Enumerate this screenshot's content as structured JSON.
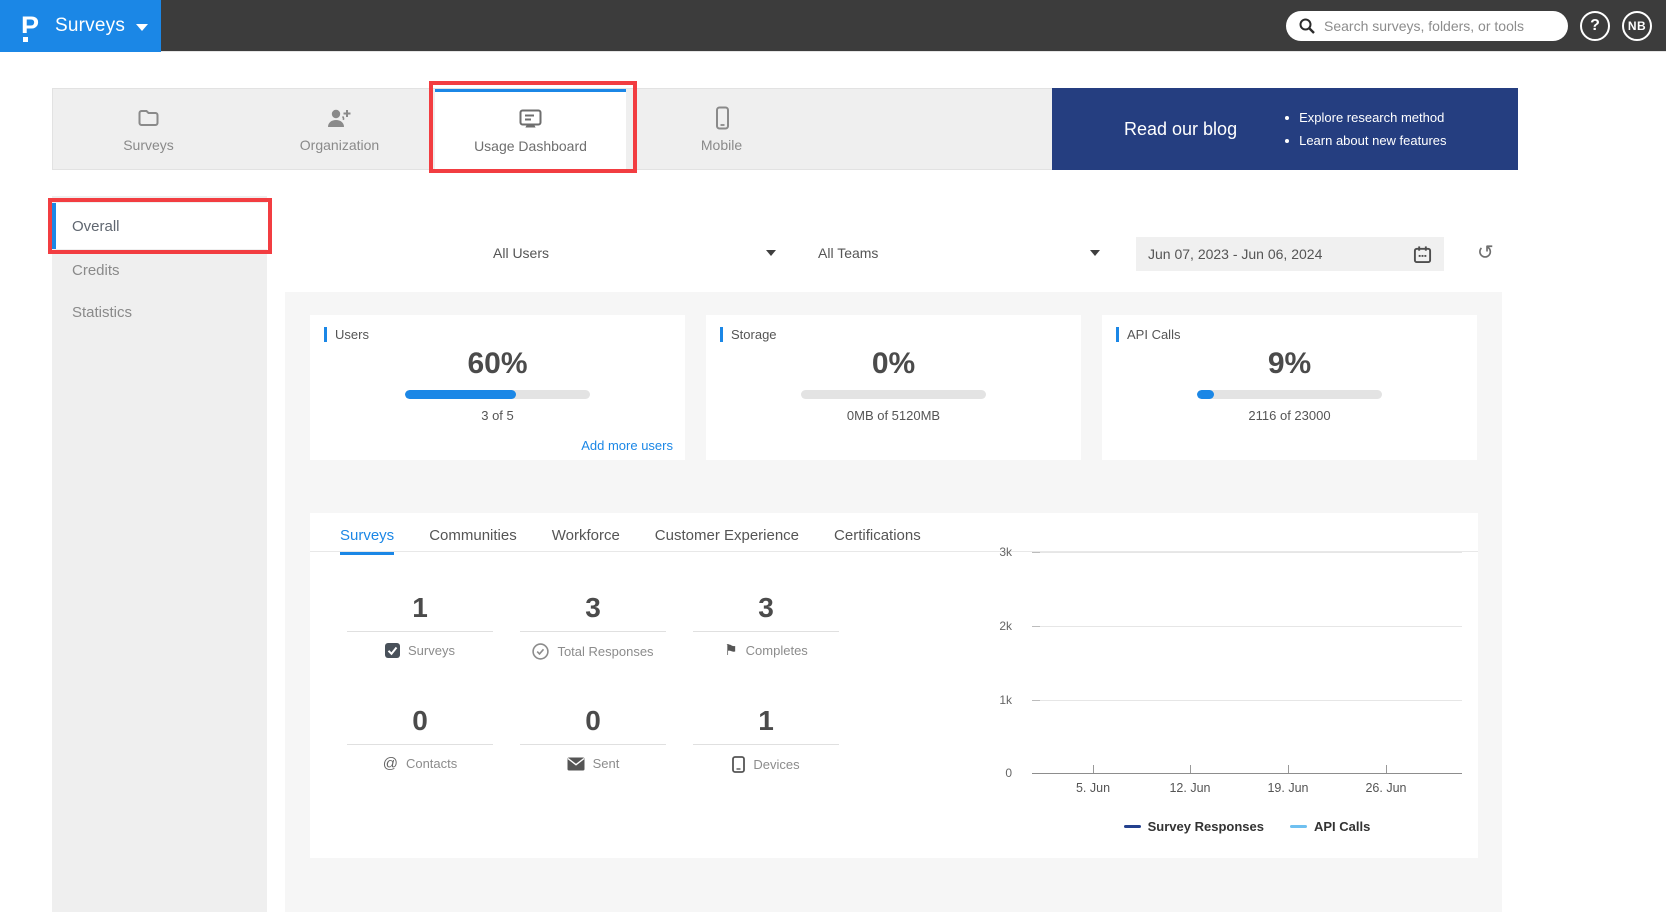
{
  "topbar": {
    "logo": "P",
    "product": "Surveys",
    "search_placeholder": "Search surveys, folders, or tools",
    "help_label": "?",
    "avatar_initials": "NB"
  },
  "nav_tabs": {
    "items": [
      {
        "label": "Surveys",
        "icon": "folder-icon",
        "active": false
      },
      {
        "label": "Organization",
        "icon": "person-add-icon",
        "active": false
      },
      {
        "label": "Usage Dashboard",
        "icon": "dashboard-icon",
        "active": true
      },
      {
        "label": "Mobile",
        "icon": "mobile-icon",
        "active": false
      }
    ]
  },
  "banner": {
    "title": "Read our blog",
    "bullets": [
      "Explore research method",
      "Learn about new features"
    ]
  },
  "sidebar": {
    "items": [
      {
        "label": "Overall",
        "active": true
      },
      {
        "label": "Credits",
        "active": false
      },
      {
        "label": "Statistics",
        "active": false
      }
    ]
  },
  "filters": {
    "users": "All Users",
    "teams": "All Teams",
    "date_range": "Jun 07, 2023 - Jun 06, 2024"
  },
  "usage_cards": [
    {
      "title": "Users",
      "percent": "60%",
      "progress": 60,
      "caption": "3 of 5",
      "link": "Add more users"
    },
    {
      "title": "Storage",
      "percent": "0%",
      "progress": 0,
      "caption": "0MB of 5120MB"
    },
    {
      "title": "API Calls",
      "percent": "9%",
      "progress": 9,
      "caption": "2116 of 23000"
    }
  ],
  "product_tabs": {
    "items": [
      {
        "label": "Surveys",
        "active": true
      },
      {
        "label": "Communities",
        "active": false
      },
      {
        "label": "Workforce",
        "active": false
      },
      {
        "label": "Customer Experience",
        "active": false
      },
      {
        "label": "Certifications",
        "active": false
      }
    ]
  },
  "stats": {
    "items": [
      {
        "value": "1",
        "label": "Surveys",
        "icon": "checkbox-icon"
      },
      {
        "value": "3",
        "label": "Total Responses",
        "icon": "check-circle-icon"
      },
      {
        "value": "3",
        "label": "Completes",
        "icon": "flag-icon"
      },
      {
        "value": "0",
        "label": "Contacts",
        "icon": "at-icon"
      },
      {
        "value": "0",
        "label": "Sent",
        "icon": "mail-icon"
      },
      {
        "value": "1",
        "label": "Devices",
        "icon": "device-icon"
      }
    ]
  },
  "chart_data": {
    "type": "line",
    "title": "",
    "xlabel": "",
    "ylabel": "",
    "x_ticks": [
      "5. Jun",
      "12. Jun",
      "19. Jun",
      "26. Jun"
    ],
    "y_ticks": [
      "3k",
      "2k",
      "1k",
      "0"
    ],
    "ylim": [
      0,
      3000
    ],
    "grid": "horizontal",
    "legend_position": "bottom",
    "series": [
      {
        "name": "Survey Responses",
        "color": "#24418e",
        "values": []
      },
      {
        "name": "API Calls",
        "color": "#6fc0f0",
        "values": []
      }
    ]
  },
  "colors": {
    "brand_blue": "#1b87e6",
    "banner_navy": "#253e80",
    "annotation_red": "#f23d41",
    "topbar_gray": "#3c3c3c"
  }
}
